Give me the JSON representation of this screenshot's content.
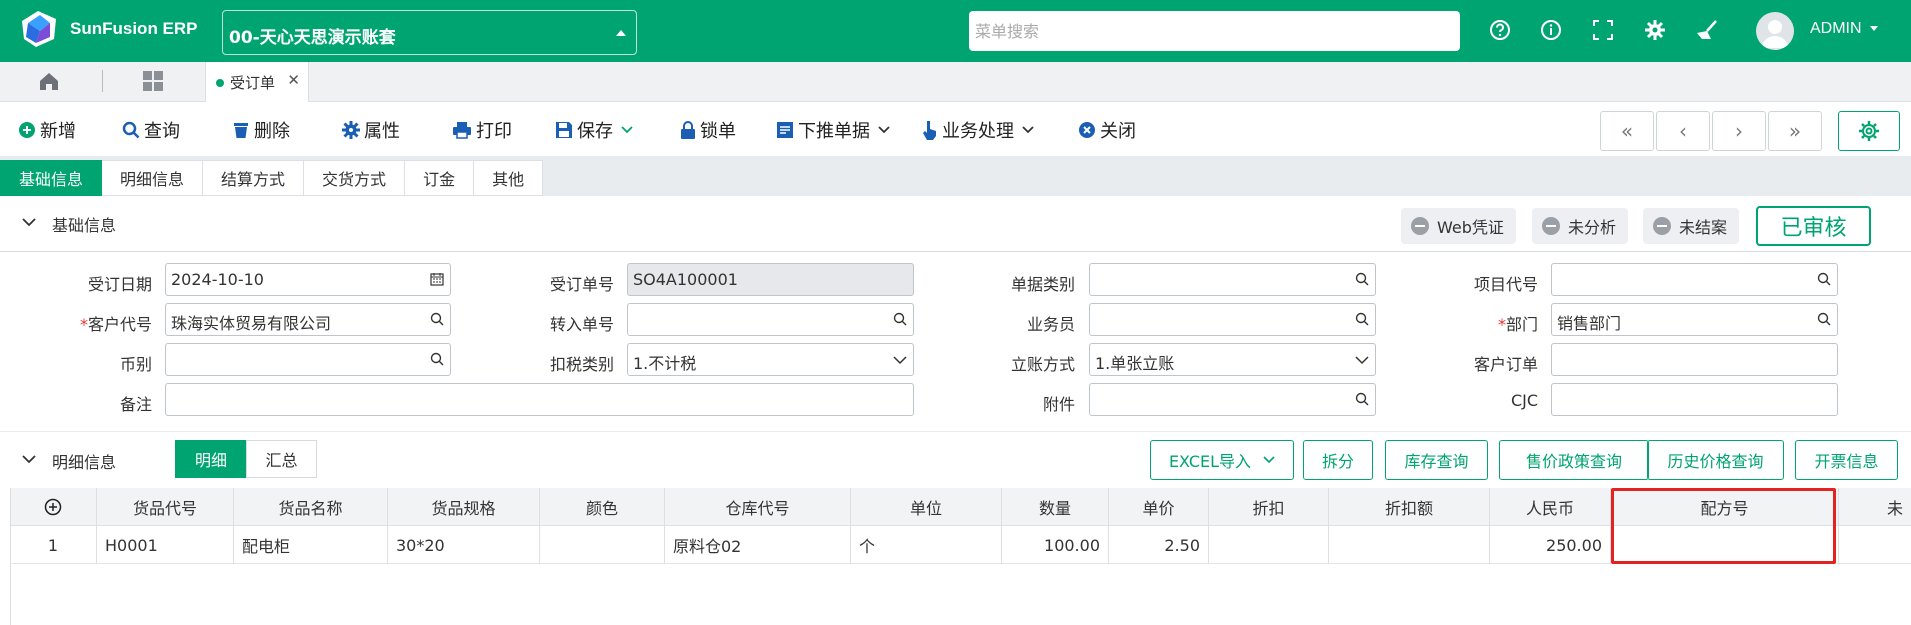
{
  "app": {
    "brand": "SunFusion ERP",
    "account": "00-天心天思演示账套",
    "search_placeholder": "菜单搜索",
    "user": "ADMIN"
  },
  "tabs": {
    "doc_tab": "受订单"
  },
  "toolbar": {
    "new": "新增",
    "query": "查询",
    "delete": "删除",
    "attributes": "属性",
    "print": "打印",
    "save": "保存",
    "lock": "锁单",
    "push_down": "下推单据",
    "business": "业务处理",
    "close": "关闭"
  },
  "section_tabs": [
    "基础信息",
    "明细信息",
    "结算方式",
    "交货方式",
    "订金",
    "其他"
  ],
  "basic": {
    "title": "基础信息",
    "chips": {
      "web": "Web凭证",
      "unanalyzed": "未分析",
      "unclosed": "未结案"
    },
    "approved": "已审核",
    "labels": {
      "order_date": "受订日期",
      "order_no": "受订单号",
      "doc_type": "单据类别",
      "project_code": "项目代号",
      "customer_code": "客户代号",
      "transfer_no": "转入单号",
      "salesperson": "业务员",
      "department": "部门",
      "currency": "币别",
      "tax_type": "扣税类别",
      "account_method": "立账方式",
      "customer_order": "客户订单",
      "remarks": "备注",
      "attachment": "附件",
      "cjc": "CJC"
    },
    "values": {
      "order_date": "2024-10-10",
      "order_no": "SO4A100001",
      "customer_code": "珠海实体贸易有限公司",
      "department": "销售部门",
      "tax_type": "1.不计税",
      "account_method": "1.单张立账"
    },
    "required_mark": "*"
  },
  "detail": {
    "title": "明细信息",
    "views": [
      "明细",
      "汇总"
    ],
    "buttons": {
      "excel": "EXCEL导入",
      "split": "拆分",
      "stock": "库存查询",
      "policy": "售价政策查询",
      "history": "历史价格查询",
      "invoice": "开票信息"
    },
    "columns": [
      "货品代号",
      "货品名称",
      "货品规格",
      "颜色",
      "仓库代号",
      "单位",
      "数量",
      "单价",
      "折扣",
      "折扣额",
      "人民币",
      "配方号",
      "未"
    ],
    "rows": [
      {
        "no": "1",
        "code": "H0001",
        "name": "配电柜",
        "spec": "30*20",
        "color": "",
        "warehouse": "原料仓02",
        "unit": "个",
        "qty": "100.00",
        "price": "2.50",
        "discount": "",
        "discount_amt": "",
        "rmb": "250.00",
        "formula": ""
      }
    ]
  }
}
